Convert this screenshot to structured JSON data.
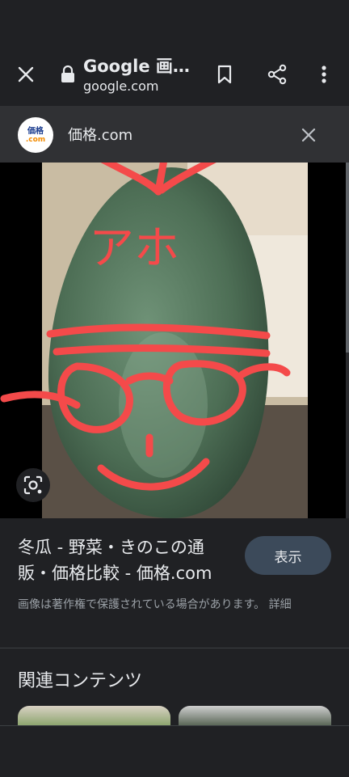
{
  "toolbar": {
    "title": "Google 画像検索",
    "domain": "google.com"
  },
  "source": {
    "logo_line1": "価格",
    "logo_line2": ".com",
    "name": "価格.com"
  },
  "image": {
    "annotation_text": "アホ"
  },
  "result": {
    "title": "冬瓜 - 野菜・きのこの通販・価格比較 - 価格.com",
    "view_label": "表示",
    "copyright": "画像は著作権で保護されている場合があります。 詳細"
  },
  "related": {
    "title": "関連コンテンツ"
  },
  "colors": {
    "background": "#202124",
    "source_bar": "#303134",
    "annotation_red": "#f44a4a",
    "button": "#3c4a5a"
  }
}
